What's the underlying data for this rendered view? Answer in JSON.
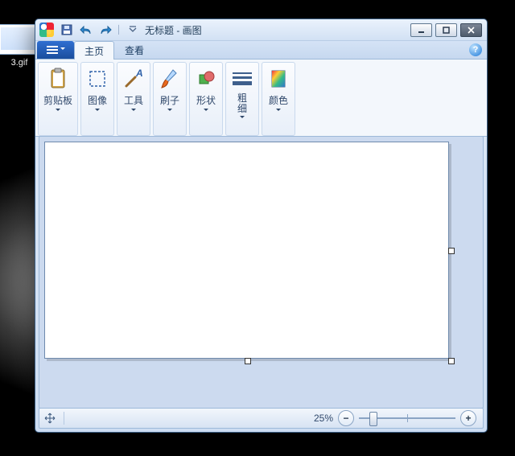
{
  "desktop": {
    "file_label": "3.gif"
  },
  "titlebar": {
    "title": "无标题 - 画图"
  },
  "tabs": {
    "home": "主页",
    "view": "查看"
  },
  "ribbon": {
    "clipboard": "剪贴板",
    "image": "图像",
    "tools": "工具",
    "brushes": "刷子",
    "shapes": "形状",
    "thickness_l1": "粗",
    "thickness_l2": "细",
    "colors": "颜色"
  },
  "status": {
    "zoom_label": "25%",
    "slider_pos_pct": 12
  }
}
